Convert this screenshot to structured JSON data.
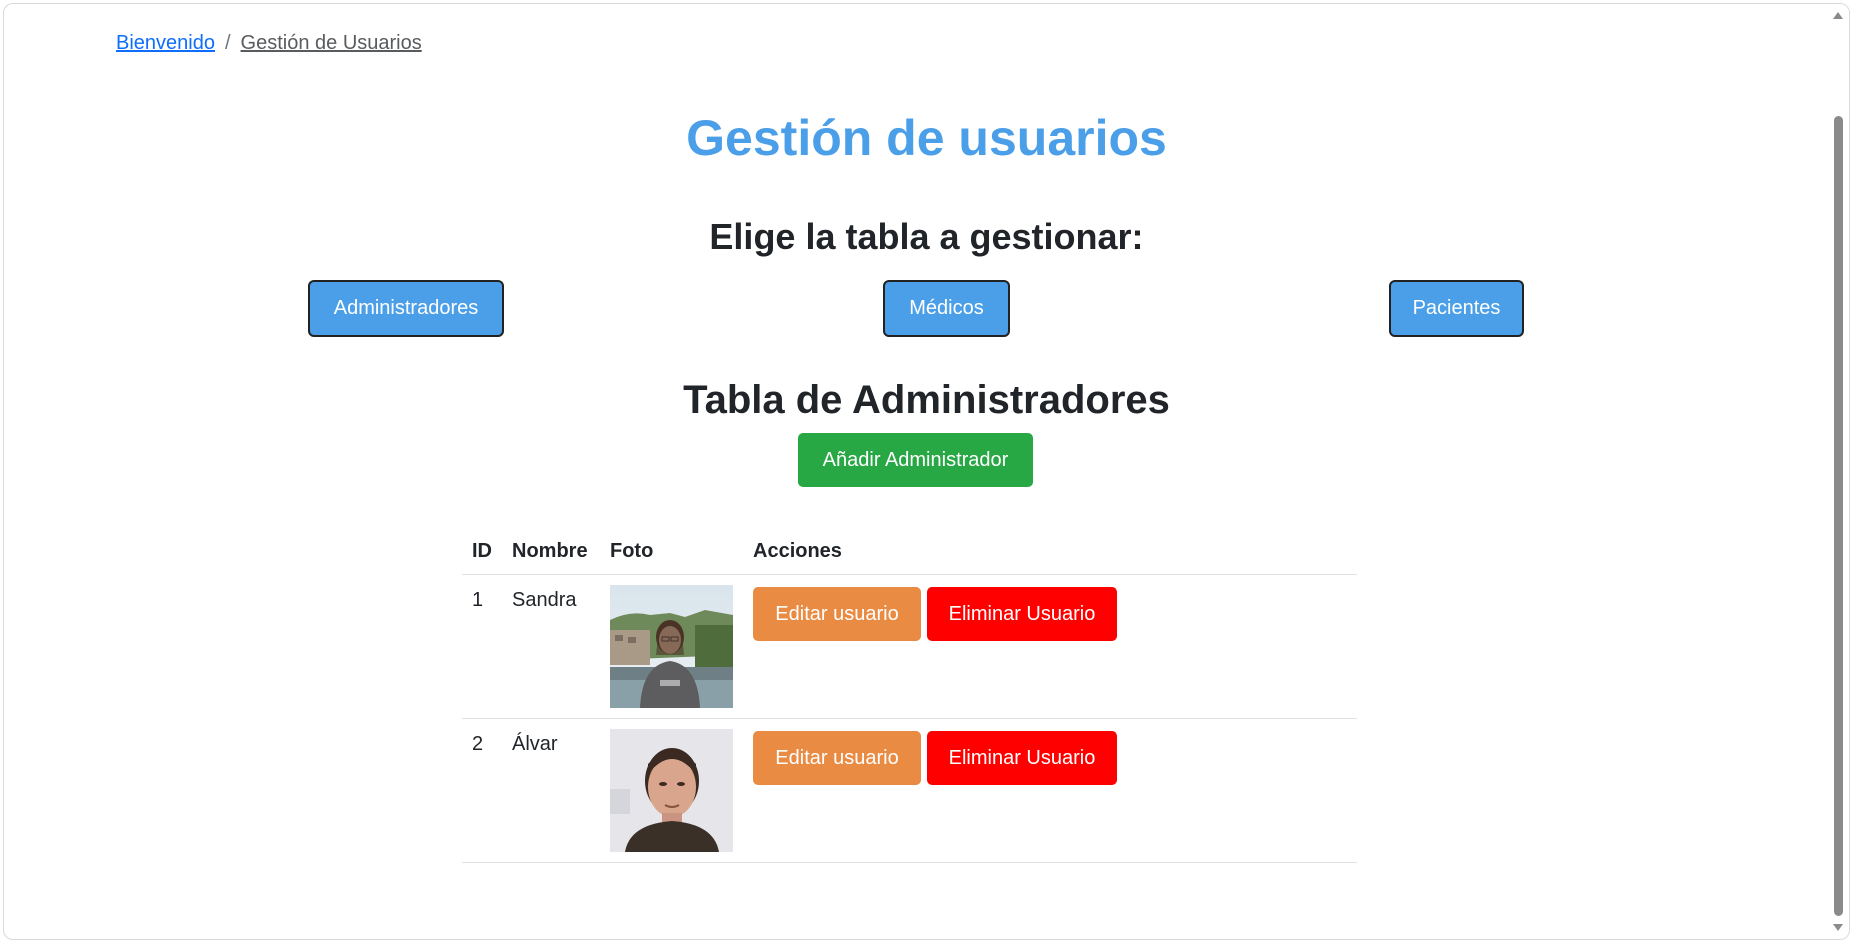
{
  "breadcrumb": {
    "home": "Bienvenido",
    "separator": "/",
    "current": "Gestión de Usuarios"
  },
  "page_title": "Gestión de usuarios",
  "choose_title": "Elige la tabla a gestionar:",
  "table_buttons": {
    "admin": "Administradores",
    "medicos": "Médicos",
    "pacientes": "Pacientes"
  },
  "table_title": "Tabla de Administradores",
  "add_button": "Añadir Administrador",
  "table": {
    "headers": [
      "ID",
      "Nombre",
      "Foto",
      "Acciones"
    ],
    "rows": [
      {
        "id": "1",
        "name": "Sandra",
        "edit": "Editar usuario",
        "delete": "Eliminar Usuario"
      },
      {
        "id": "2",
        "name": "Álvar",
        "edit": "Editar usuario",
        "delete": "Eliminar Usuario"
      }
    ]
  },
  "colors": {
    "title": "#4a9fe8",
    "primary_button": "#4a9fe8",
    "add_button": "#28a745",
    "edit_button": "#e98b42",
    "delete_button": "#ff0000"
  }
}
